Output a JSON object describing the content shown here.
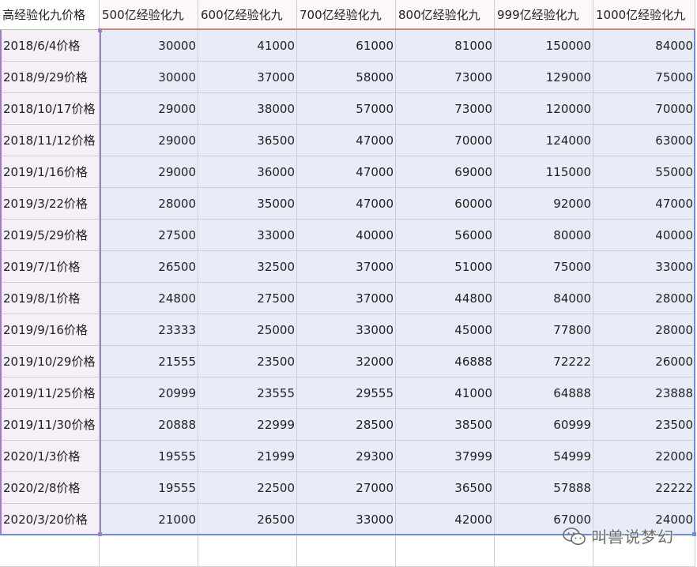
{
  "sheet": {
    "header": [
      "高经验化九价格",
      "500亿经验化九",
      "600亿经验化九",
      "700亿经验化九",
      "800亿经验化九",
      "999亿经验化九",
      "1000亿经验化九"
    ],
    "rows": [
      [
        "2018/6/4价格",
        "30000",
        "41000",
        "61000",
        "81000",
        "150000",
        "84000"
      ],
      [
        "2018/9/29价格",
        "30000",
        "37000",
        "58000",
        "73000",
        "129000",
        "75000"
      ],
      [
        "2018/10/17价格",
        "29000",
        "38000",
        "57000",
        "73000",
        "120000",
        "70000"
      ],
      [
        "2018/11/12价格",
        "29000",
        "36500",
        "47000",
        "70000",
        "124000",
        "63000"
      ],
      [
        "2019/1/16价格",
        "29000",
        "36000",
        "47000",
        "69000",
        "115000",
        "55000"
      ],
      [
        "2019/3/22价格",
        "28000",
        "35000",
        "47000",
        "60000",
        "92000",
        "47000"
      ],
      [
        "2019/5/29价格",
        "27500",
        "33000",
        "40000",
        "56000",
        "80000",
        "40000"
      ],
      [
        "2019/7/1价格",
        "26500",
        "32500",
        "37000",
        "51000",
        "75000",
        "33000"
      ],
      [
        "2019/8/1价格",
        "24800",
        "27500",
        "37000",
        "44800",
        "84000",
        "28000"
      ],
      [
        "2019/9/16价格",
        "23333",
        "25000",
        "33000",
        "45000",
        "77800",
        "28000"
      ],
      [
        "2019/10/29价格",
        "21555",
        "23500",
        "32000",
        "46888",
        "72222",
        "26000"
      ],
      [
        "2019/11/25价格",
        "20999",
        "23555",
        "29555",
        "41000",
        "64888",
        "23888"
      ],
      [
        "2019/11/30价格",
        "20888",
        "22999",
        "28500",
        "38500",
        "60999",
        "23500"
      ],
      [
        "2020/1/3价格",
        "19555",
        "21999",
        "29300",
        "37999",
        "54999",
        "22000"
      ],
      [
        "2020/2/8价格",
        "19555",
        "22500",
        "27000",
        "36500",
        "57888",
        "22222"
      ],
      [
        "2020/3/20价格",
        "21000",
        "26500",
        "33000",
        "42000",
        "67000",
        "24000"
      ]
    ]
  },
  "watermark": {
    "text": "叫兽说梦幻",
    "icon": "wechat-icon"
  },
  "colors": {
    "row_label_fill": "#f6eff8",
    "value_fill": "#e8ecf8",
    "header_fill": "#fdf8f7",
    "selection_purple": "#9f7fbf",
    "selection_blue": "#6d8fc9",
    "header_accent": "#c28b82"
  }
}
